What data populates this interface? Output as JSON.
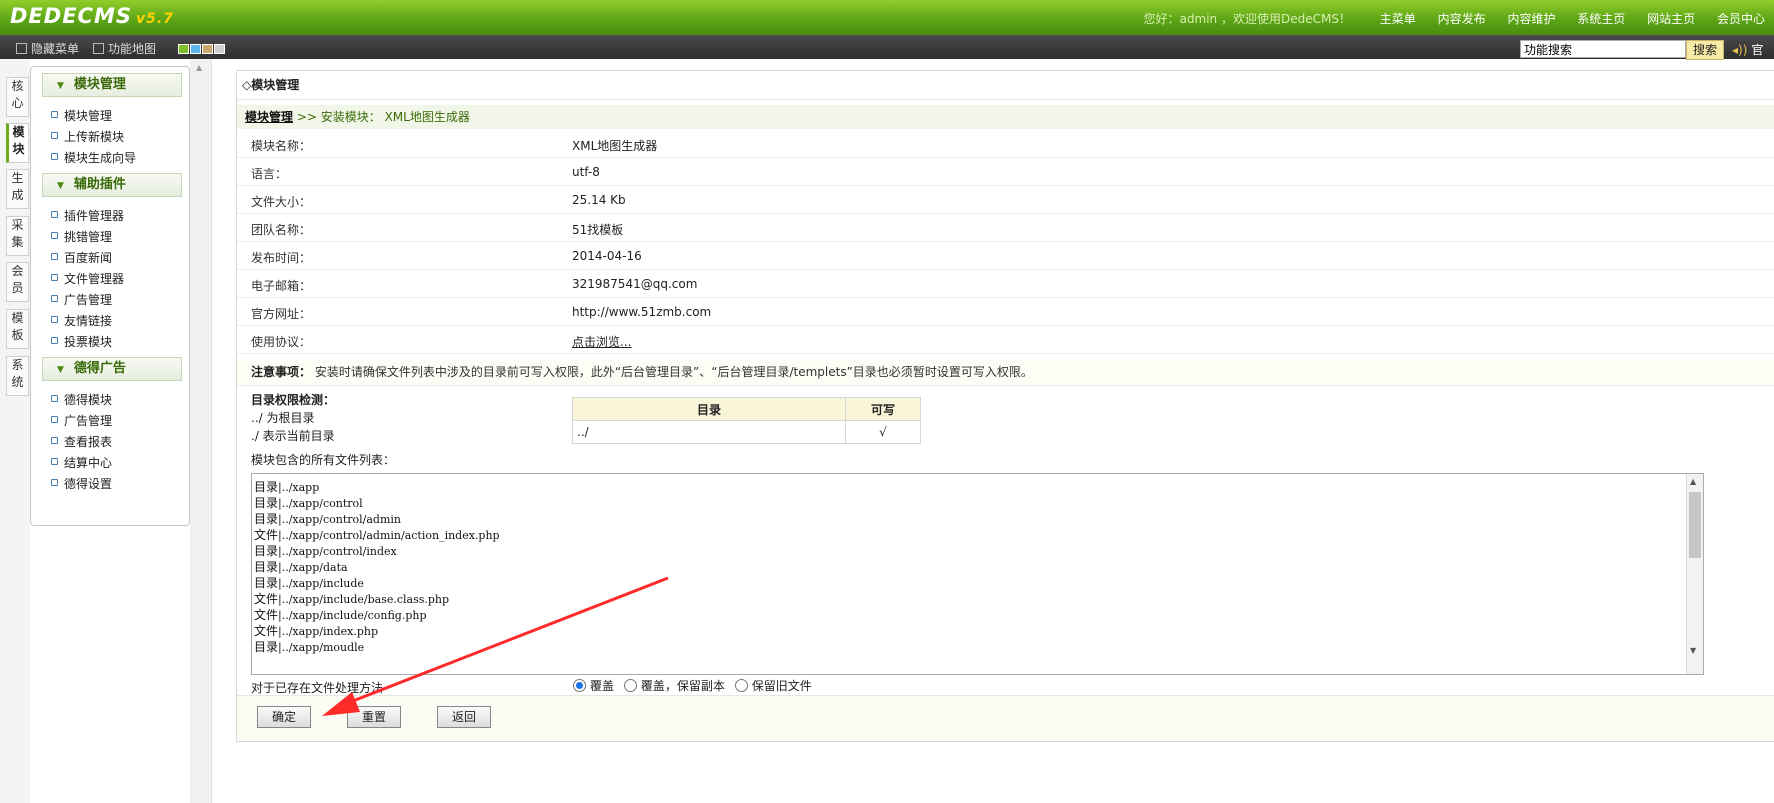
{
  "header": {
    "logo": "DEDECMS",
    "version": "v5.7",
    "welcome": "您好：admin ，欢迎使用DedeCMS！",
    "nav": [
      "主菜单",
      "内容发布",
      "内容维护",
      "系统主页",
      "网站主页",
      "会员中心"
    ]
  },
  "toolbar": {
    "hide_menu": "隐藏菜单",
    "site_map": "功能地图",
    "search_placeholder": "功能搜索",
    "search_button": "搜索",
    "official": "官方"
  },
  "vtabs": [
    "核心",
    "模块",
    "生成",
    "采集",
    "会员",
    "模板",
    "系统"
  ],
  "menu": {
    "groups": [
      {
        "title": "模块管理",
        "items": [
          "模块管理",
          "上传新模块",
          "模块生成向导"
        ]
      },
      {
        "title": "辅助插件",
        "items": [
          "插件管理器",
          "挑错管理",
          "百度新闻",
          "文件管理器",
          "广告管理",
          "友情链接",
          "投票模块"
        ]
      },
      {
        "title": "德得广告",
        "items": [
          "德得模块",
          "广告管理",
          "查看报表",
          "结算中心",
          "德得设置"
        ]
      }
    ]
  },
  "main": {
    "title": "◇模块管理",
    "crumb_link": "模块管理",
    "crumb_rest": " >> 安装模块： XML地图生成器",
    "fields": [
      {
        "k": "模块名称：",
        "v": "XML地图生成器"
      },
      {
        "k": "语言：",
        "v": "utf-8"
      },
      {
        "k": "文件大小：",
        "v": "25.14 Kb"
      },
      {
        "k": "团队名称：",
        "v": "51找模板"
      },
      {
        "k": "发布时间：",
        "v": "2014-04-16"
      },
      {
        "k": "电子邮箱：",
        "v": "321987541@qq.com"
      },
      {
        "k": "官方网址：",
        "v": "http://www.51zmb.com"
      },
      {
        "k": "使用协议：",
        "v": "点击浏览..."
      }
    ],
    "notice_label": "注意事项：",
    "notice_text": " 安装时请确保文件列表中涉及的目录前可写入权限，此外“后台管理目录”、“后台管理目录/templets”目录也必须暂时设置可写入权限。",
    "perm_title": "目录权限检测：",
    "perm_line1": "../ 为根目录",
    "perm_line2": "./ 表示当前目录",
    "perm_table": {
      "col1": "目录",
      "col2": "可写",
      "dir": "../",
      "writable": "√"
    },
    "file_list_label": "模块包含的所有文件列表：",
    "files": [
      {
        "type": "目录",
        "path": "|../xapp"
      },
      {
        "type": "目录",
        "path": "|../xapp/control"
      },
      {
        "type": "目录",
        "path": "|../xapp/control/admin"
      },
      {
        "type": "文件",
        "path": "|../xapp/control/admin/action_index.php"
      },
      {
        "type": "目录",
        "path": "|../xapp/control/index"
      },
      {
        "type": "目录",
        "path": "|../xapp/data"
      },
      {
        "type": "目录",
        "path": "|../xapp/include"
      },
      {
        "type": "文件",
        "path": "|../xapp/include/base.class.php"
      },
      {
        "type": "文件",
        "path": "|../xapp/include/config.php"
      },
      {
        "type": "文件",
        "path": "|../xapp/index.php"
      },
      {
        "type": "目录",
        "path": "|../xapp/moudle"
      }
    ],
    "handle_label": "对于已存在文件处理方法",
    "options": [
      "覆盖",
      "覆盖，保留副本",
      "保留旧文件"
    ],
    "buttons": {
      "ok": "确定",
      "reset": "重置",
      "back": "返回"
    }
  },
  "colors": {
    "header_green": "#5aa314",
    "accent_red": "#ff2a2a",
    "crumb_bg": "#f1f6e8"
  }
}
